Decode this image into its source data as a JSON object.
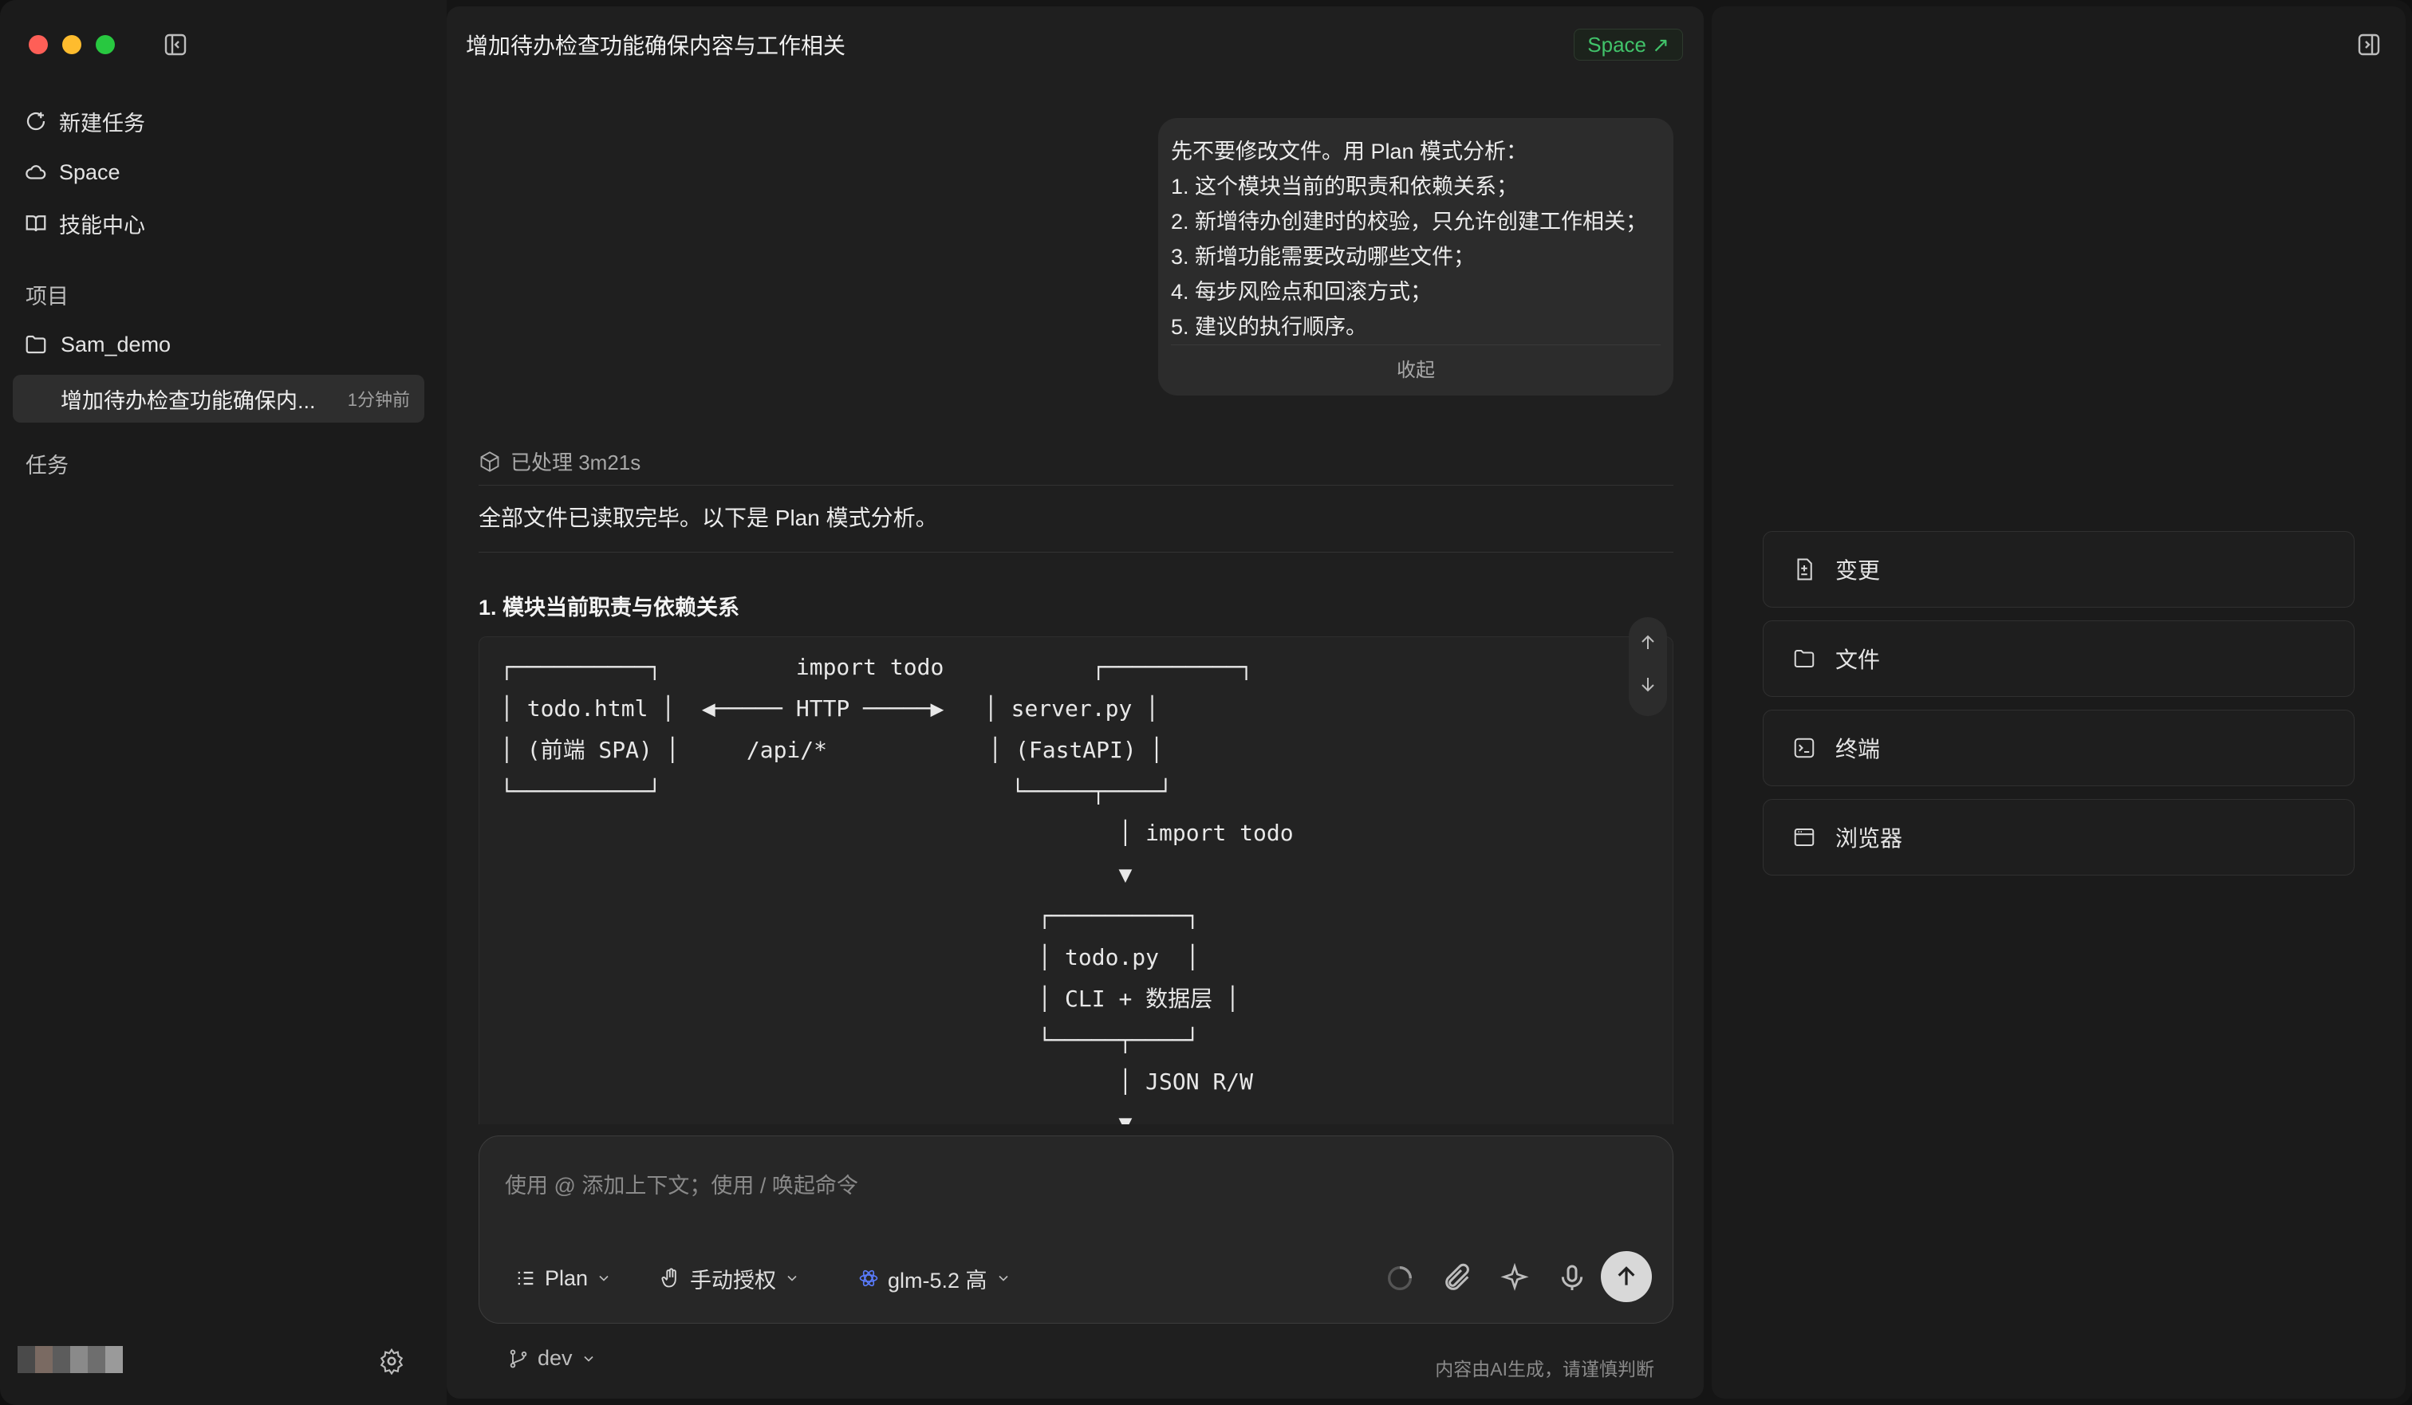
{
  "sidebar": {
    "nav": [
      {
        "label": "新建任务",
        "icon": "new-task-icon"
      },
      {
        "label": "Space",
        "icon": "cloud-icon"
      },
      {
        "label": "技能中心",
        "icon": "book-icon"
      }
    ],
    "projects_label": "项目",
    "project": {
      "name": "Sam_demo",
      "icon": "folder-icon"
    },
    "active_task": {
      "title": "增加待办检查功能确保内...",
      "time": "1分钟前"
    },
    "tasks_label": "任务"
  },
  "main": {
    "title": "增加待办检查功能确保内容与工作相关",
    "space_badge": "Space ↗",
    "user_message": {
      "lines": [
        "先不要修改文件。用 Plan 模式分析：",
        "1. 这个模块当前的职责和依赖关系；",
        "2. 新增待办创建时的校验，只允许创建工作相关；",
        "3. 新增功能需要改动哪些文件；",
        "4. 每步风险点和回滚方式；",
        "5. 建议的执行顺序。"
      ],
      "collapse": "收起"
    },
    "processed": "已处理 3m21s",
    "intro": "全部文件已读取完毕。以下是 Plan 模式分析。",
    "heading": "1. 模块当前职责与依赖关系",
    "code": "┌──────────┐          import todo           ┌──────────┐\n│ todo.html │  ◀───── HTTP ─────▶   │ server.py │\n│ (前端 SPA) │     /api/*            │ (FastAPI) │\n└──────────┘                          └─────┬────┘\n                                              │ import todo\n                                              ▼\n                                        ┌──────────┐\n                                        │ todo.py  │\n                                        │ CLI + 数据层 │\n                                        └─────┬────┘\n                                              │ JSON R/W\n                                              ▼",
    "composer": {
      "placeholder": "使用 @ 添加上下文；使用 / 唤起命令",
      "mode": "Plan",
      "permission": "手动授权",
      "model": "glm-5.2 高"
    },
    "branch": "dev",
    "disclaimer": "内容由AI生成，请谨慎判断"
  },
  "right_panel": {
    "cards": [
      {
        "label": "变更",
        "icon": "diff-icon"
      },
      {
        "label": "文件",
        "icon": "folder-icon"
      },
      {
        "label": "终端",
        "icon": "terminal-icon"
      },
      {
        "label": "浏览器",
        "icon": "browser-icon"
      }
    ]
  },
  "colors": {
    "accent_green": "#41c36a",
    "traffic_red": "#fe5f57",
    "traffic_yellow": "#febc2e",
    "traffic_green": "#28c840"
  }
}
